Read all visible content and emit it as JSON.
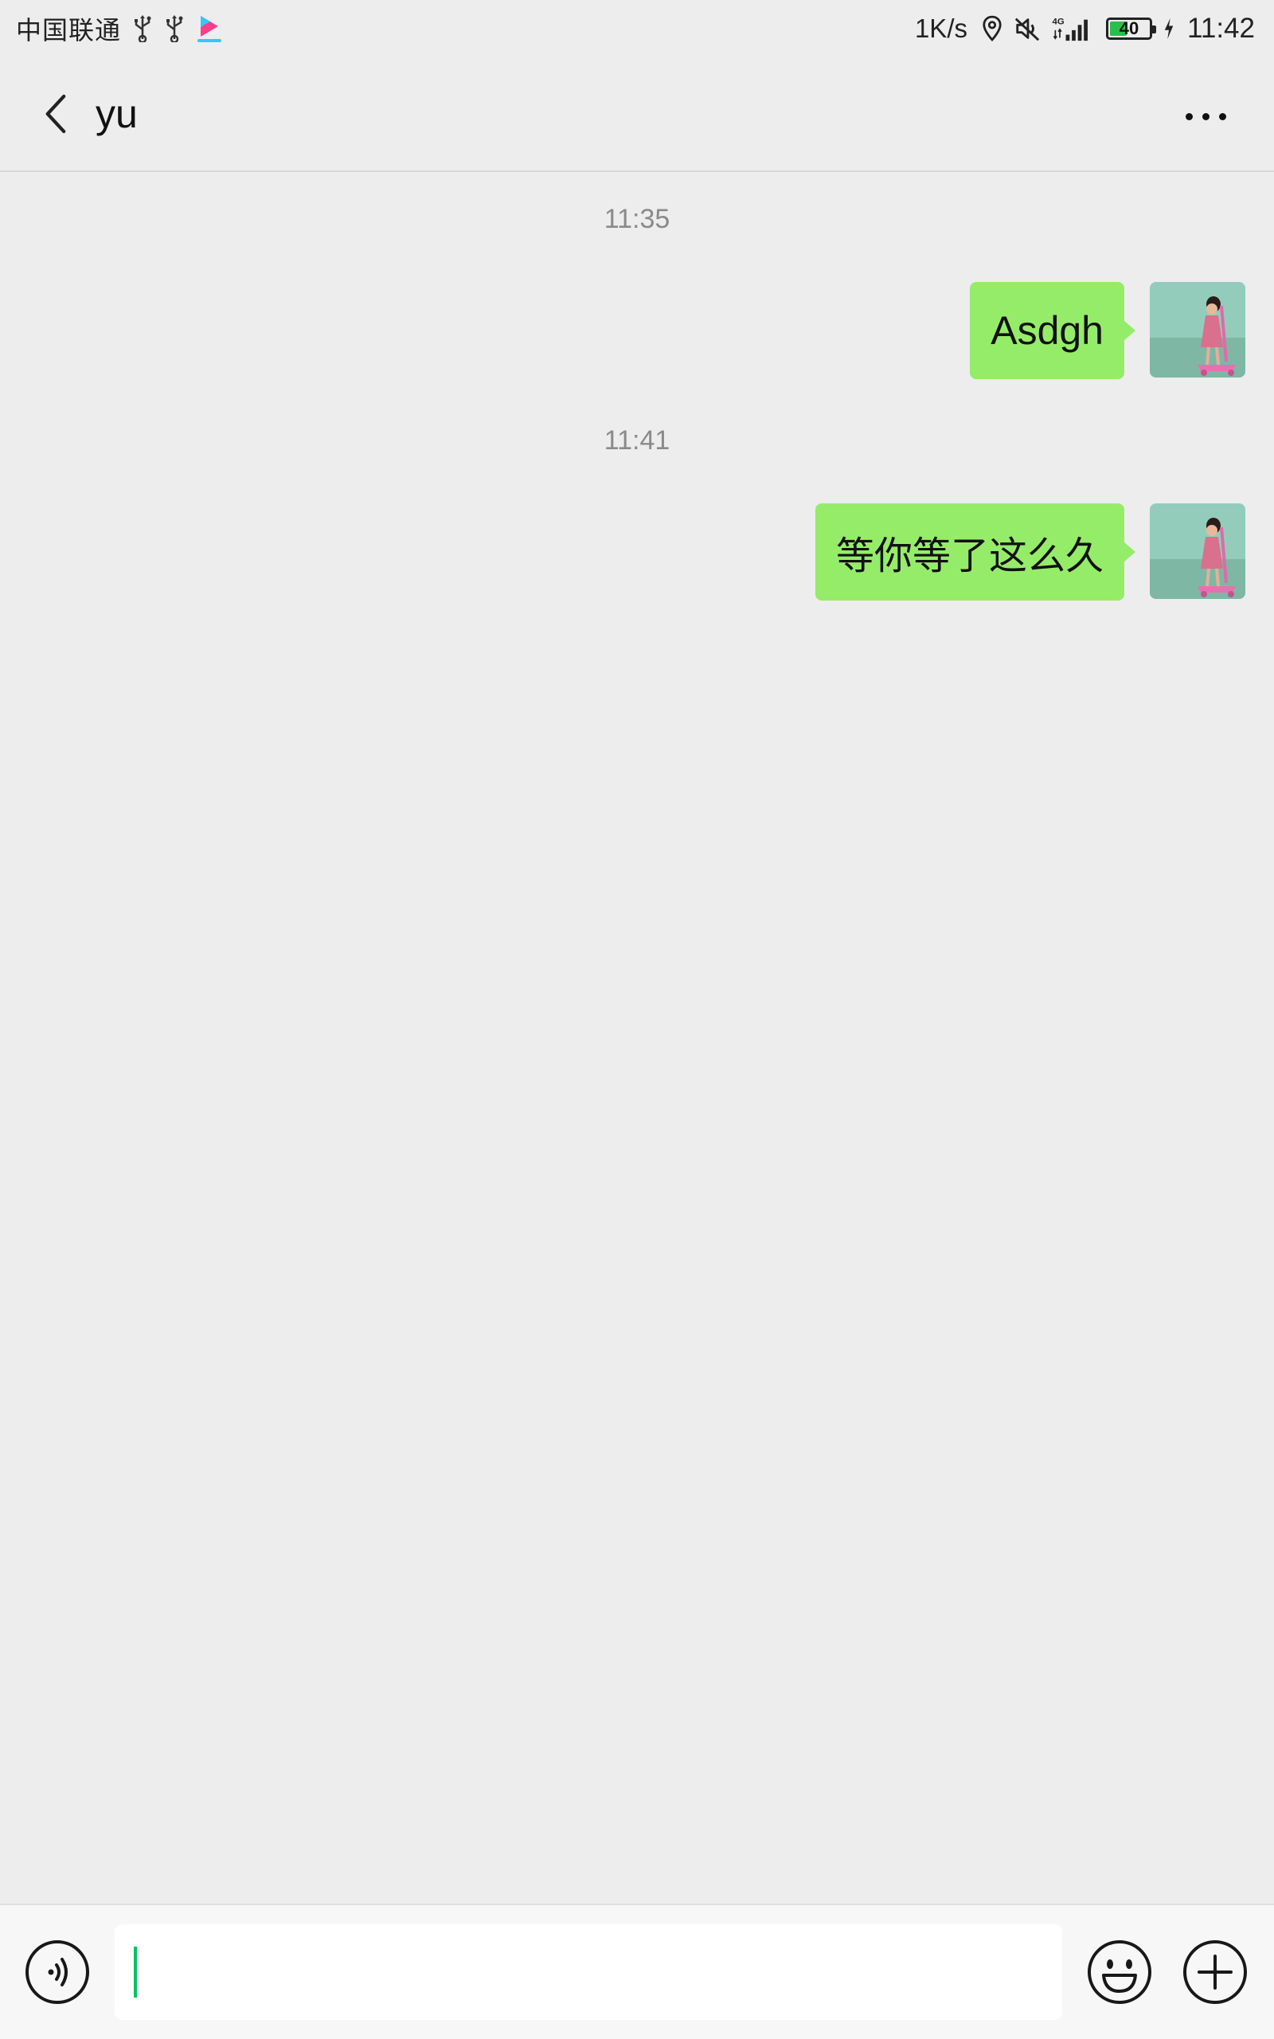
{
  "status_bar": {
    "carrier": "中国联通",
    "net_speed": "1K/s",
    "network_type": "4G",
    "battery_level": "40",
    "battery_fraction": 0.4,
    "time": "11:42",
    "icons": [
      "usb-icon",
      "usb-icon",
      "youku-icon",
      "location-icon",
      "mute-icon",
      "signal-icon",
      "battery-icon",
      "charging-icon"
    ]
  },
  "header": {
    "title": "yu",
    "back_icon": "chevron-left-icon",
    "more_icon": "more-dots-icon"
  },
  "messages": [
    {
      "timestamp": "11:35",
      "text": "Asdgh",
      "sender": "me"
    },
    {
      "timestamp": "11:41",
      "text": "等你等了这么久",
      "sender": "me"
    }
  ],
  "input_bar": {
    "value": "",
    "placeholder": "",
    "left_icon": "voice-icon",
    "right_icons": [
      "emoji-icon",
      "plus-icon"
    ]
  },
  "colors": {
    "background": "#ededed",
    "bubble_self": "#95ec69",
    "caret": "#07c160",
    "timestamp": "#8a8a8a"
  }
}
